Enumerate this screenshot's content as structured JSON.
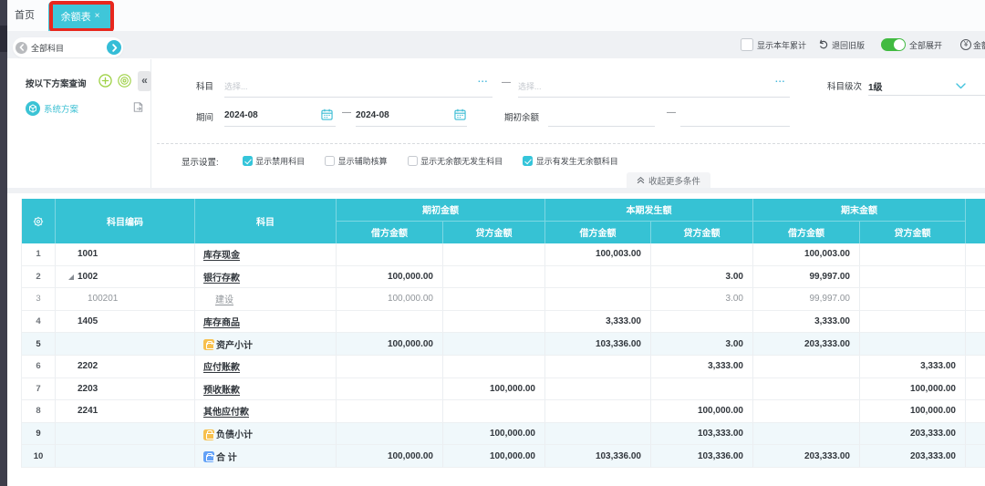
{
  "colors": {
    "brand_teal": "#36c2d4",
    "tab_active_bg": "#3fc6d9",
    "annotation_red": "#e8271d",
    "table_header_bg": "#36c2d4",
    "subtotal_row_bg": "#f0f8fb",
    "toggle_green": "#41ba41",
    "scheme_icon_green": "#9ed145",
    "subtotal_icon_yellow": "#f7c04e",
    "total_icon_blue": "#62a1f7"
  },
  "tabs": {
    "home": "首页",
    "active": "余额表",
    "close": "×"
  },
  "toolbar": {
    "subject_nav_label": "全部科目",
    "show_ytd_label": "显示本年累计",
    "revert_label": "退回旧版",
    "expand_all_label": "全部展开",
    "amount_label": "金额",
    "yen": "¥"
  },
  "sidebar": {
    "title": "按以下方案查询",
    "collapse": "«",
    "scheme_label": "系统方案"
  },
  "filters": {
    "subject_label": "科目",
    "subject_placeholder": "选择...",
    "dots": "...",
    "dash": "—",
    "level_label": "科目级次",
    "level_value": "1级",
    "period_label": "期间",
    "period_from": "2024-08",
    "period_to": "2024-08",
    "opening_label": "期初余额",
    "display_label": "显示设置:",
    "checkboxes": [
      {
        "label": "显示禁用科目",
        "checked": true
      },
      {
        "label": "显示辅助核算",
        "checked": false
      },
      {
        "label": "显示无余额无发生科目",
        "checked": false
      },
      {
        "label": "显示有发生无余额科目",
        "checked": true
      }
    ],
    "collapse_more_label": "收起更多条件"
  },
  "table": {
    "header": {
      "code": "科目编码",
      "subject": "科目",
      "groups": [
        "期初金额",
        "本期发生额",
        "期末金额"
      ],
      "debit": "借方金额",
      "credit": "贷方金额"
    },
    "rows": [
      {
        "num": "1",
        "code": "1001",
        "name": "库存现金",
        "level": 1,
        "bold": true,
        "cells": [
          "",
          "",
          "100,003.00",
          "",
          "100,003.00",
          ""
        ]
      },
      {
        "num": "2",
        "code": "1002",
        "name": "银行存款",
        "level": 1,
        "bold": true,
        "expanded": true,
        "cells": [
          "100,000.00",
          "",
          "",
          "3.00",
          "99,997.00",
          ""
        ]
      },
      {
        "num": "3",
        "code": "100201",
        "name": "建设",
        "level": 2,
        "dim": true,
        "cells": [
          "100,000.00",
          "",
          "",
          "3.00",
          "99,997.00",
          ""
        ]
      },
      {
        "num": "4",
        "code": "1405",
        "name": "库存商品",
        "level": 1,
        "bold": true,
        "cells": [
          "",
          "",
          "3,333.00",
          "",
          "3,333.00",
          ""
        ]
      },
      {
        "num": "5",
        "code": "",
        "name": "资产小计",
        "icon": "yellow",
        "subtotal": true,
        "cells": [
          "100,000.00",
          "",
          "103,336.00",
          "3.00",
          "203,333.00",
          ""
        ]
      },
      {
        "num": "6",
        "code": "2202",
        "name": "应付账款",
        "level": 1,
        "bold": true,
        "cells": [
          "",
          "",
          "",
          "3,333.00",
          "",
          "3,333.00"
        ]
      },
      {
        "num": "7",
        "code": "2203",
        "name": "预收账款",
        "level": 1,
        "bold": true,
        "cells": [
          "",
          "100,000.00",
          "",
          "",
          "",
          "100,000.00"
        ]
      },
      {
        "num": "8",
        "code": "2241",
        "name": "其他应付款",
        "level": 1,
        "bold": true,
        "cells": [
          "",
          "",
          "",
          "100,000.00",
          "",
          "100,000.00"
        ]
      },
      {
        "num": "9",
        "code": "",
        "name": "负债小计",
        "icon": "yellow",
        "subtotal": true,
        "cells": [
          "",
          "100,000.00",
          "",
          "103,333.00",
          "",
          "203,333.00"
        ]
      },
      {
        "num": "10",
        "code": "",
        "name": "合  计",
        "icon": "blue",
        "subtotal": true,
        "cells": [
          "100,000.00",
          "100,000.00",
          "103,336.00",
          "103,336.00",
          "203,333.00",
          "203,333.00"
        ]
      }
    ]
  }
}
